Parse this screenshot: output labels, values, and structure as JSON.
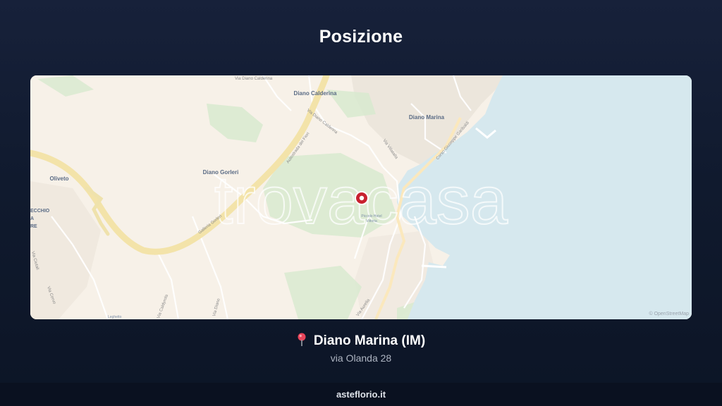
{
  "page": {
    "title": "Posizione"
  },
  "map": {
    "watermark": "trovacasa",
    "attribution": "© OpenStreetMap",
    "labels": {
      "diano_calderina": "Diano Calderina",
      "via_diano_calderina_top": "Via Diano Calderina",
      "via_diano_calderina": "Via Diano Calderina",
      "diano_marina": "Diano Marina",
      "diano_gorleri": "Diano Gorleri",
      "oliveto": "Oliveto",
      "autostrada": "Autostrada dei Fiori",
      "galleria": "Galleria Gorleri",
      "corso": "Corso Giuseppe Garibaldi",
      "via_villatalla": "Via Villatalla",
      "place_1": "Piccolo Hotel",
      "place_2": "Vittoria",
      "vecchio_1": "ECCHIO",
      "vecchio_2": "A",
      "vecchio_3": "RE",
      "via_sur": "Via Cervo",
      "via_sur2": "Via Caldyrola",
      "via_sur3": "Via Diano",
      "via_aurelia": "Via Aurelia",
      "via_left": "Via Ciutali",
      "leghetto": "Leghetto"
    },
    "marker_icon": "map-marker-icon"
  },
  "location": {
    "pin_icon": "pushpin-icon",
    "city": "Diano Marina (IM)",
    "address": "via Olanda 28"
  },
  "footer": {
    "site": "asteflorio.it"
  }
}
